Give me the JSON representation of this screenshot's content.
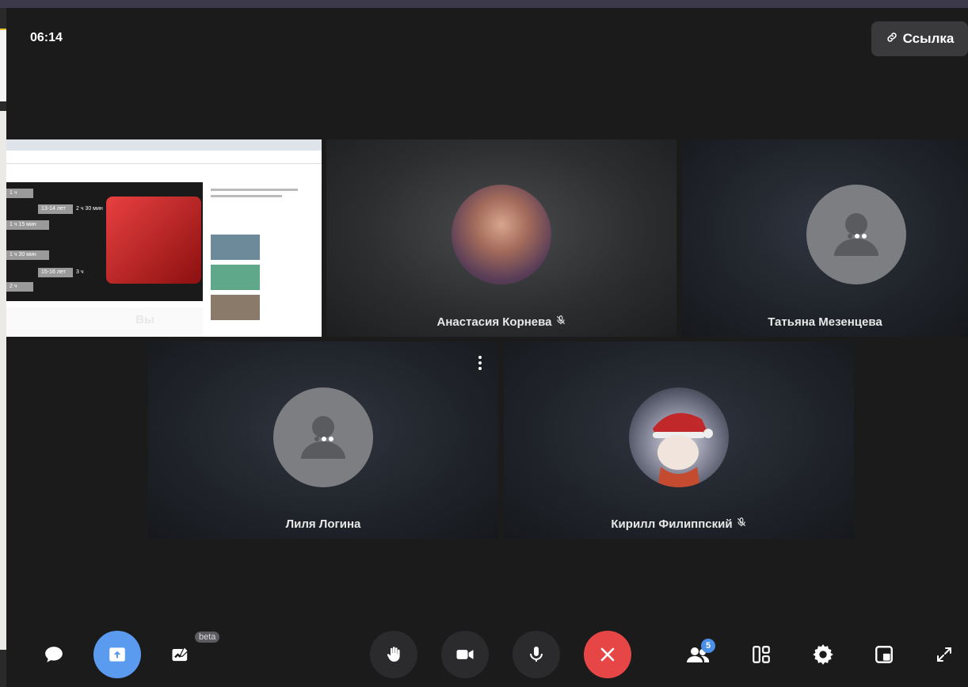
{
  "header": {
    "timer": "06:14",
    "link_button_label": "Ссылка"
  },
  "participants": {
    "self": {
      "label": "Вы"
    },
    "p1": {
      "name": "Анастасия Корнева",
      "muted": true
    },
    "p2": {
      "name": "Татьяна Мезенцева",
      "muted": false
    },
    "p3": {
      "name": "Лиля Логина",
      "muted": false
    },
    "p4": {
      "name": "Кирилл Филиппский",
      "muted": true
    }
  },
  "screen_share": {
    "slide_labels": [
      "1 ч",
      "13-14 лет",
      "2 ч 30 мин",
      "1 ч 15 мин",
      "1 ч 30 мин",
      "15-16 лет",
      "3 ч",
      "2 ч"
    ]
  },
  "controls": {
    "beta_label": "beta",
    "participants_count": "5"
  },
  "colors": {
    "background": "#1b1b1c",
    "accent_blue": "#5a9bf0",
    "hangup_red": "#e64646"
  }
}
